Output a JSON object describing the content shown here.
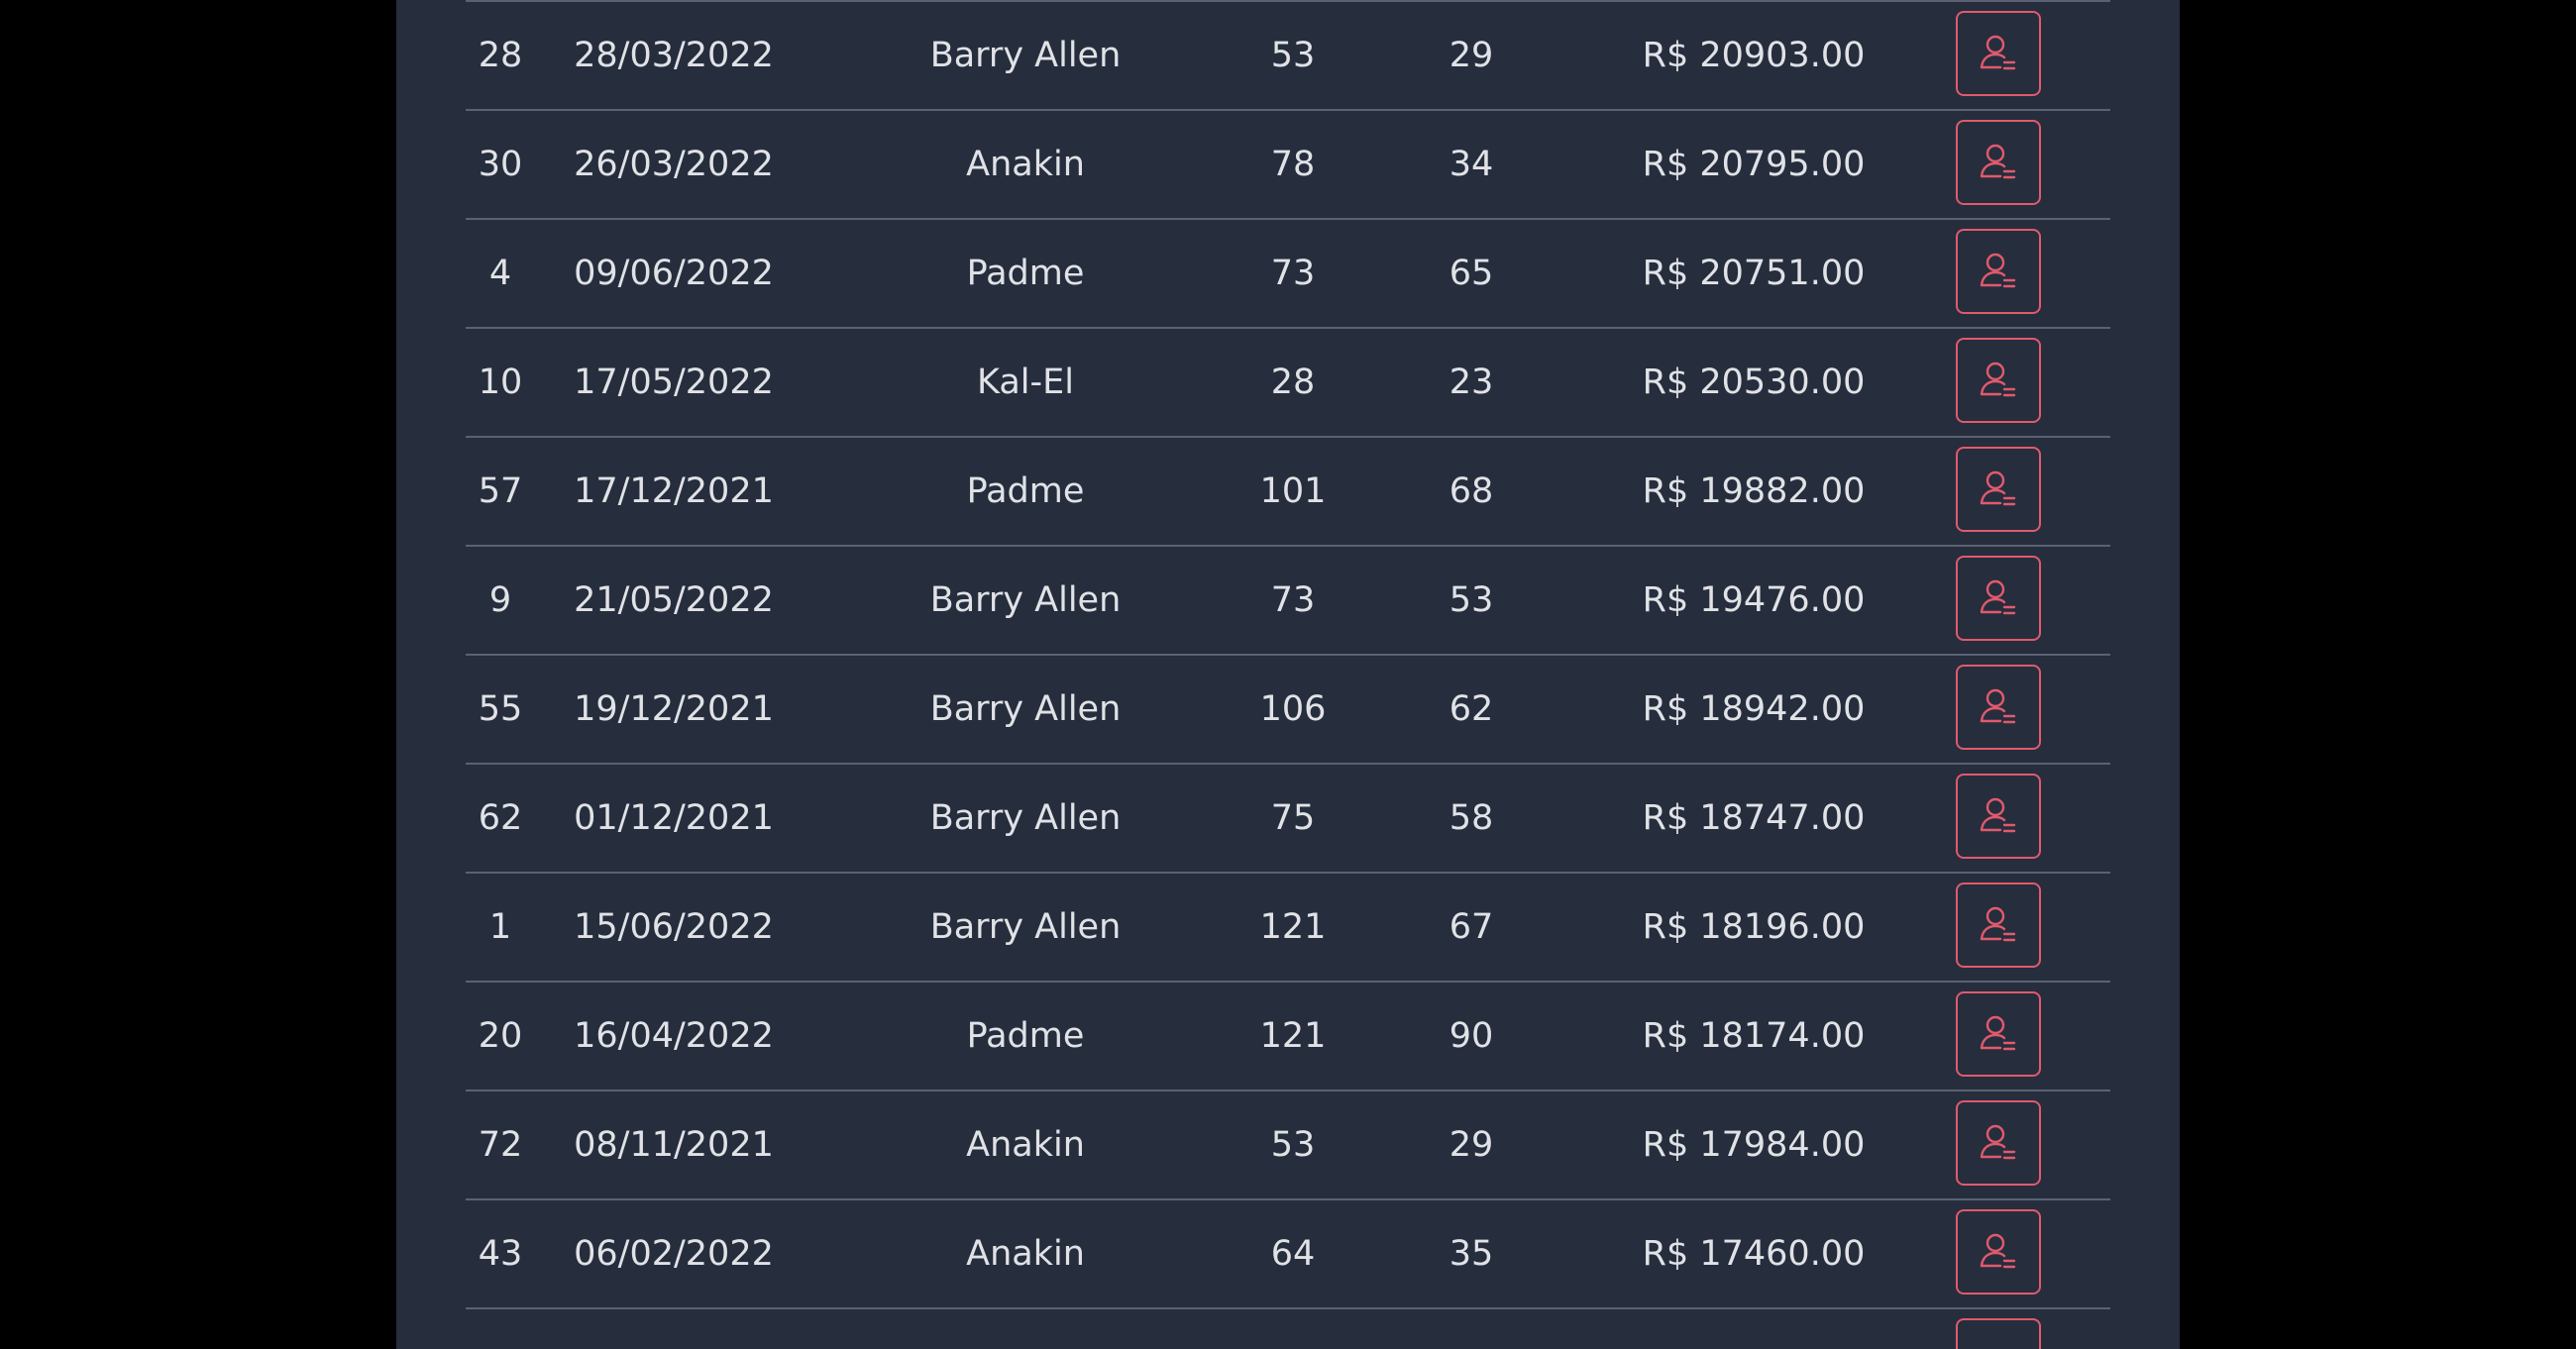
{
  "accent_color": "#e05a6d",
  "action_icon": "user-remove-icon",
  "rows": [
    {
      "id": "28",
      "date": "28/03/2022",
      "name": "Barry Allen",
      "a": "53",
      "b": "29",
      "value": "R$ 20903.00"
    },
    {
      "id": "30",
      "date": "26/03/2022",
      "name": "Anakin",
      "a": "78",
      "b": "34",
      "value": "R$ 20795.00"
    },
    {
      "id": "4",
      "date": "09/06/2022",
      "name": "Padme",
      "a": "73",
      "b": "65",
      "value": "R$ 20751.00"
    },
    {
      "id": "10",
      "date": "17/05/2022",
      "name": "Kal-El",
      "a": "28",
      "b": "23",
      "value": "R$ 20530.00"
    },
    {
      "id": "57",
      "date": "17/12/2021",
      "name": "Padme",
      "a": "101",
      "b": "68",
      "value": "R$ 19882.00"
    },
    {
      "id": "9",
      "date": "21/05/2022",
      "name": "Barry Allen",
      "a": "73",
      "b": "53",
      "value": "R$ 19476.00"
    },
    {
      "id": "55",
      "date": "19/12/2021",
      "name": "Barry Allen",
      "a": "106",
      "b": "62",
      "value": "R$ 18942.00"
    },
    {
      "id": "62",
      "date": "01/12/2021",
      "name": "Barry Allen",
      "a": "75",
      "b": "58",
      "value": "R$ 18747.00"
    },
    {
      "id": "1",
      "date": "15/06/2022",
      "name": "Barry Allen",
      "a": "121",
      "b": "67",
      "value": "R$ 18196.00"
    },
    {
      "id": "20",
      "date": "16/04/2022",
      "name": "Padme",
      "a": "121",
      "b": "90",
      "value": "R$ 18174.00"
    },
    {
      "id": "72",
      "date": "08/11/2021",
      "name": "Anakin",
      "a": "53",
      "b": "29",
      "value": "R$ 17984.00"
    },
    {
      "id": "43",
      "date": "06/02/2022",
      "name": "Anakin",
      "a": "64",
      "b": "35",
      "value": "R$ 17460.00"
    }
  ]
}
